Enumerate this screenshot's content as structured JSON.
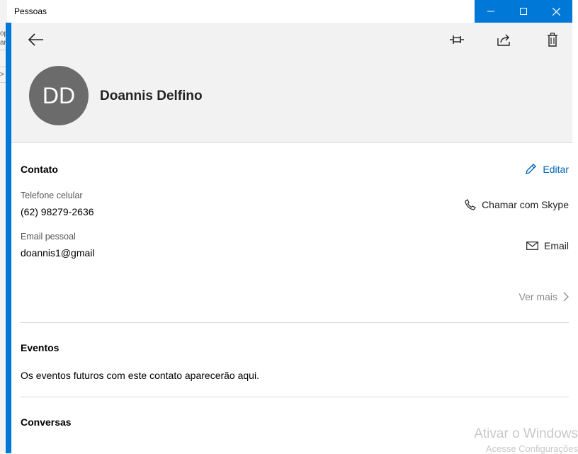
{
  "window": {
    "title": "Pessoas"
  },
  "header": {
    "initials": "DD",
    "name": "Doannis Delfino"
  },
  "contato": {
    "title": "Contato",
    "edit_label": "Editar",
    "phone_label": "Telefone celular",
    "phone_value": "(62) 98279-2636",
    "phone_action": "Chamar com Skype",
    "email_label": "Email pessoal",
    "email_value": "doannis1@gmail",
    "email_action": "Email",
    "more_label": "Ver mais"
  },
  "eventos": {
    "title": "Eventos",
    "text": "Os eventos futuros com este contato aparecerão aqui."
  },
  "conversas": {
    "title": "Conversas"
  },
  "watermark": {
    "line1": "Ativar o Windows",
    "line2": "Acesse Configurações"
  },
  "colors": {
    "accent": "#0078d7",
    "link": "#0067b8",
    "avatar": "#6b6b6b"
  }
}
